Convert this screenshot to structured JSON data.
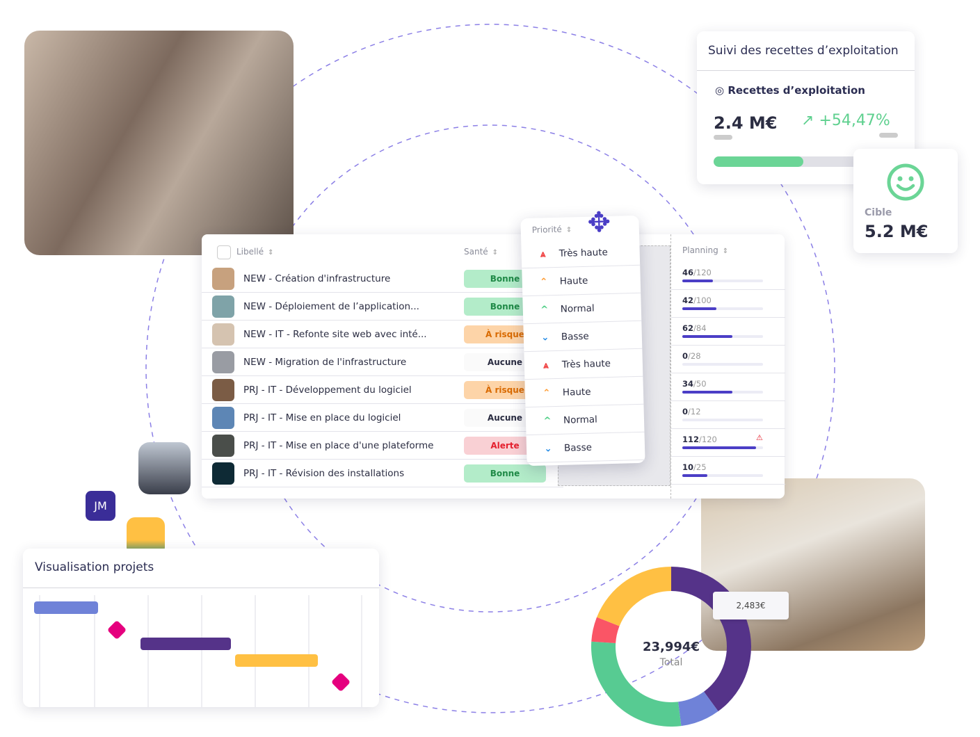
{
  "colors": {
    "accent": "#4b3ec6",
    "green": "#6bd596",
    "purple": "#553389",
    "yellow": "#ffc043",
    "pink": "#e5007e",
    "lavender": "#6f82d8",
    "red": "#fa5566"
  },
  "table": {
    "headers": {
      "label": "Libellé",
      "health": "Santé",
      "priority": "Priorité",
      "planning": "Planning"
    },
    "rows": [
      {
        "label": "NEW - Création d'infrastructure",
        "health": "Bonne",
        "priority": "Très haute",
        "done": "46",
        "total": "/120",
        "pct": 38
      },
      {
        "label": "NEW - Déploiement de l’application...",
        "health": "Bonne",
        "priority": "Haute",
        "done": "42",
        "total": "/100",
        "pct": 42
      },
      {
        "label": "NEW - IT - Refonte site web avec inté...",
        "health": "À risque",
        "priority": "Normal",
        "done": "62",
        "total": "/84",
        "pct": 62
      },
      {
        "label": "NEW - Migration de l'infrastructure",
        "health": "Aucune",
        "priority": "Basse",
        "done": "0",
        "total": "/28",
        "pct": 0
      },
      {
        "label": "PRJ - IT - Développement du logiciel",
        "health": "À risque",
        "priority": "Très haute",
        "done": "34",
        "total": "/50",
        "pct": 62
      },
      {
        "label": "PRJ - IT - Mise en place du logiciel",
        "health": "Aucune",
        "priority": "Haute",
        "done": "0",
        "total": "/12",
        "pct": 0
      },
      {
        "label": "PRJ - IT - Mise en place d'une plateforme",
        "health": "Alerte",
        "priority": "Normal",
        "done": "112",
        "total": "/120",
        "pct": 91,
        "warning": true
      },
      {
        "label": "PRJ - IT - Révision des installations",
        "health": "Bonne",
        "priority": "Basse",
        "done": "10",
        "total": "/25",
        "pct": 31
      }
    ]
  },
  "revenue": {
    "title": "Suivi des recettes d’exploitation",
    "subtitle": "Recettes d’exploitation",
    "value": "2.4 M€",
    "trend": "+54,47%",
    "progress_pct": 46
  },
  "target": {
    "label": "Cible",
    "value": "5.2 M€"
  },
  "gantt": {
    "title": "Visualisation projets"
  },
  "avatar_initials": "JM",
  "chart_data": {
    "type": "pie",
    "donut": true,
    "center_value": "23,994€",
    "center_label": "Total",
    "tooltip": "2,483€",
    "slices": [
      {
        "color": "#553389",
        "share": 40
      },
      {
        "color": "#6f82d8",
        "share": 8
      },
      {
        "color": "#57cb92",
        "share": 28
      },
      {
        "color": "#fa5566",
        "share": 5
      },
      {
        "color": "#ffc043",
        "share": 19
      }
    ]
  }
}
